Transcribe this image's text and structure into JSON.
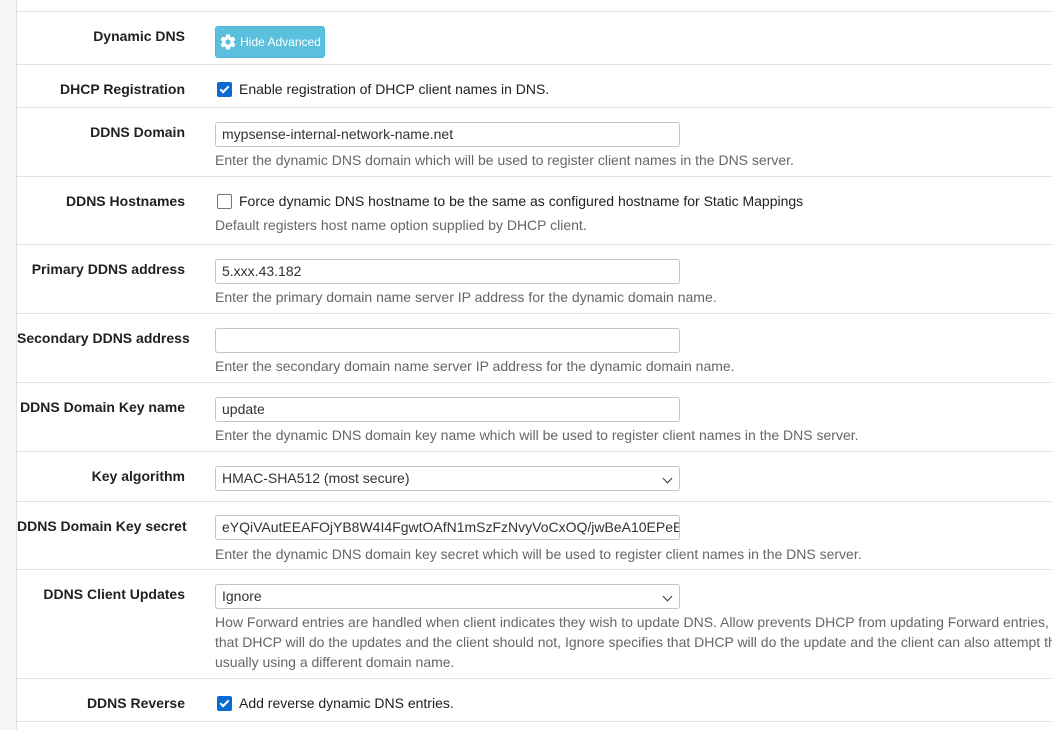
{
  "dynamic_dns": {
    "label": "Dynamic DNS",
    "button_label": "Hide Advanced",
    "button_icon": "gear-icon"
  },
  "dhcp_registration": {
    "label": "DHCP Registration",
    "checkbox_text": "Enable registration of DHCP client names in DNS.",
    "checked": true
  },
  "ddns_domain": {
    "label": "DDNS Domain",
    "value": "mypsense-internal-network-name.net",
    "help": "Enter the dynamic DNS domain which will be used to register client names in the DNS server."
  },
  "ddns_hostnames": {
    "label": "DDNS Hostnames",
    "checkbox_text": "Force dynamic DNS hostname to be the same as configured hostname for Static Mappings",
    "checked": false,
    "help": "Default registers host name option supplied by DHCP client."
  },
  "primary_ddns": {
    "label": "Primary DDNS address",
    "value": "5.xxx.43.182",
    "help": "Enter the primary domain name server IP address for the dynamic domain name."
  },
  "secondary_ddns": {
    "label": "Secondary DDNS address",
    "value": "",
    "help": "Enter the secondary domain name server IP address for the dynamic domain name."
  },
  "ddns_key_name": {
    "label": "DDNS Domain Key name",
    "value": "update",
    "help": "Enter the dynamic DNS domain key name which will be used to register client names in the DNS server."
  },
  "key_algorithm": {
    "label": "Key algorithm",
    "selected": "HMAC-SHA512 (most secure)"
  },
  "ddns_key_secret": {
    "label": "DDNS Domain Key secret",
    "value": "eYQiVAutEEAFOjYB8W4I4FgwtOAfN1mSzFzNvyVoCxOQ/jwBeA10EPeE",
    "help": "Enter the dynamic DNS domain key secret which will be used to register client names in the DNS server."
  },
  "ddns_client_updates": {
    "label": "DDNS Client Updates",
    "selected": "Ignore",
    "help_lines": [
      "How Forward entries are handled when client indicates they wish to update DNS. Allow prevents DHCP from updating Forward entries, D",
      "that DHCP will do the updates and the client should not, Ignore specifies that DHCP will do the update and the client can also attempt th",
      "usually using a different domain name."
    ]
  },
  "ddns_reverse": {
    "label": "DDNS Reverse",
    "checkbox_text": "Add reverse dynamic DNS entries.",
    "checked": true
  }
}
